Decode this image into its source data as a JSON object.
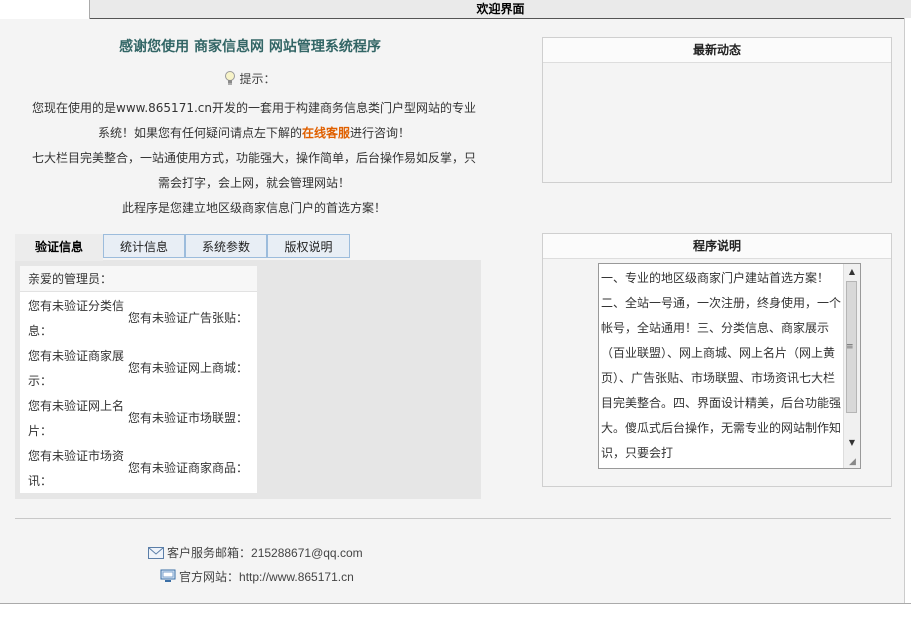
{
  "header": {
    "title": "欢迎界面"
  },
  "welcome": {
    "title": "感谢您使用 商家信息网 网站管理系统程序",
    "hint_label": "提示：",
    "intro_line1": "您现在使用的是www.865171.cn开发的一套用于构建商务信息类门户型网站的专业系统！如果您有任何疑问请点左下解的",
    "service_link": "在线客服",
    "intro_line1_tail": "进行咨询！",
    "intro_line2": "七大栏目完美整合，一站通使用方式，功能强大，操作简单，后台操作易如反掌，只需会打字，会上网，就会管理网站！",
    "intro_line3": "此程序是您建立地区级商家信息门户的首选方案！"
  },
  "tabs": [
    {
      "label": "验证信息",
      "active": true
    },
    {
      "label": "统计信息",
      "active": false
    },
    {
      "label": "系统参数",
      "active": false
    },
    {
      "label": "版权说明",
      "active": false
    }
  ],
  "verify": {
    "greeting": "亲爱的管理员：",
    "rows": [
      {
        "left": "您有未验证分类信息：",
        "right": "您有未验证广告张贴："
      },
      {
        "left": "您有未验证商家展示：",
        "right": "您有未验证网上商城："
      },
      {
        "left": "您有未验证网上名片：",
        "right": "您有未验证市场联盟："
      },
      {
        "left": "您有未验证市场资讯：",
        "right": "您有未验证商家商品："
      }
    ]
  },
  "news_panel": {
    "title": "最新动态"
  },
  "program_panel": {
    "title": "程序说明",
    "text": "一、专业的地区级商家门户建站首选方案！二、全站一号通，一次注册，终身使用，一个帐号，全站通用！三、分类信息、商家展示（百业联盟）、网上商城、网上名片（网上黄页）、广告张贴、市场联盟、市场资讯七大栏目完美整合。四、界面设计精美，后台功能强大。傻瓜式后台操作，无需专业的网站制作知识，只要会打"
  },
  "contact": {
    "email_label": "客户服务邮箱：",
    "email": "215288671@qq.com",
    "site_label": "官方网站：",
    "site": "http://www.865171.cn"
  },
  "colors": {
    "title_teal": "#336666",
    "link_orange": "#e06000",
    "tab_border": "#9cbcdc"
  }
}
